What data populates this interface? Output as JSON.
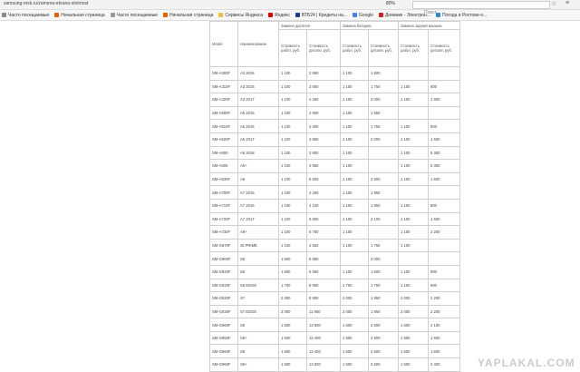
{
  "browser": {
    "url": "samsung-msk.ru/zamena-ekrana-stoimost",
    "zoom": "80%",
    "search_placeholder": "Поиск",
    "bookmarks": [
      {
        "label": "Часто посещаемые",
        "icon": "star-icon",
        "color": "#888888"
      },
      {
        "label": "Начальная страница",
        "icon": "firefox-icon",
        "color": "#e66000"
      },
      {
        "label": "Часто посещаемые",
        "icon": "document-icon",
        "color": "#999999"
      },
      {
        "label": "Начальная страница",
        "icon": "firefox-icon",
        "color": "#e66000"
      },
      {
        "label": "Сервисы Яндекса",
        "icon": "folder-icon",
        "color": "#f0c040"
      },
      {
        "label": "Яндекс",
        "icon": "yandex-icon",
        "color": "#e00000"
      },
      {
        "label": "ВТБ24 | Кредиты на...",
        "icon": "vtb-icon",
        "color": "#1a3d8f"
      },
      {
        "label": "Google",
        "icon": "google-icon",
        "color": "#4285f4"
      },
      {
        "label": "Дневник - Электрон...",
        "icon": "diary-icon",
        "color": "#d22020"
      },
      {
        "label": "Погода в Ростове-н...",
        "icon": "weather-icon",
        "color": "#2a8ad4"
      }
    ]
  },
  "table": {
    "col_model": "Model",
    "col_name": "Наименование",
    "groups": [
      "Замена дисплея",
      "Замена батареи",
      "Замена задней крышки"
    ],
    "sub_headers": [
      "Стоимость работ, руб.",
      "Стоимость детали, руб."
    ],
    "rows": [
      [
        "SM-A300F",
        "A3 2015",
        "1 100",
        "2 850",
        "1 100",
        "1 600",
        "",
        ""
      ],
      [
        "SM-A310F",
        "A3 2016",
        "1 100",
        "3 600",
        "1 100",
        "1 750",
        "1 100",
        "800"
      ],
      [
        "SM-A320F",
        "A3 2017",
        "1 100",
        "4 250",
        "1 100",
        "2 000",
        "1 100",
        "1 900"
      ],
      [
        "SM-A500F",
        "A5 2015",
        "1 100",
        "2 900",
        "1 100",
        "1 650",
        "",
        ""
      ],
      [
        "SM-A510F",
        "A5 2016",
        "1 100",
        "4 300",
        "1 100",
        "1 750",
        "1 100",
        "800"
      ],
      [
        "SM-A520F",
        "A5 2017",
        "1 100",
        "4 850",
        "1 100",
        "2 000",
        "1 100",
        "1 600"
      ],
      [
        "SM-A600",
        "A6 2018",
        "1 100",
        "2 800",
        "1 100",
        "",
        "1 100",
        "5 350"
      ],
      [
        "SM-A605",
        "A6+",
        "1 100",
        "3 950",
        "1 100",
        "",
        "1 100",
        "5 350"
      ],
      [
        "SM-A530F",
        "A8",
        "1 100",
        "5 500",
        "1 100",
        "2 500",
        "1 100",
        "1 600"
      ],
      [
        "SM-A700F",
        "A7 2015",
        "1 100",
        "4 250",
        "1 100",
        "1 850",
        "",
        ""
      ],
      [
        "SM-A710F",
        "A7 2016",
        "1 100",
        "4 100",
        "1 100",
        "1 850",
        "1 100",
        "800"
      ],
      [
        "SM-A720F",
        "A7 2017",
        "1 100",
        "5 900",
        "1 100",
        "2 100",
        "1 100",
        "1 600"
      ],
      [
        "SM-A730F",
        "A8+",
        "1 100",
        "5 750",
        "1 100",
        "",
        "1 100",
        "2 250"
      ],
      [
        "SM-G570F",
        "J5 PRIME",
        "1 100",
        "4 550",
        "1 100",
        "1 750",
        "1 100",
        ""
      ],
      [
        "SM-G900F",
        "S5",
        "1 600",
        "5 850",
        "",
        "2 000",
        "",
        ""
      ],
      [
        "SM-G920F",
        "S6",
        "1 600",
        "6 550",
        "1 100",
        "1 600",
        "1 100",
        "900"
      ],
      [
        "SM-G925F",
        "S6 EDGE",
        "1 700",
        "8 900",
        "1 700",
        "1 700",
        "1 100",
        "900"
      ],
      [
        "SM-G930F",
        "S7",
        "2 000",
        "6 900",
        "2 000",
        "1 950",
        "2 000",
        "2 200"
      ],
      [
        "SM-G935F",
        "S7 EDGE",
        "2 000",
        "11 950",
        "2 000",
        "1 950",
        "2 000",
        "2 200"
      ],
      [
        "SM-G960F",
        "S8",
        "1 600",
        "13 600",
        "1 600",
        "2 600",
        "1 600",
        "2 100"
      ],
      [
        "SM-G955F",
        "S8+",
        "1 600",
        "13 400",
        "1 600",
        "2 600",
        "1 600",
        "1 600"
      ],
      [
        "SM-G960F",
        "S9",
        "1 600",
        "13 400",
        "1 600",
        "2 600",
        "1 600",
        "1 600"
      ],
      [
        "SM-G965F",
        "S9+",
        "1 600",
        "13 000",
        "1 600",
        "2 600",
        "1 600",
        "2 400"
      ]
    ]
  },
  "watermark": "YAPLAKAL.COM"
}
